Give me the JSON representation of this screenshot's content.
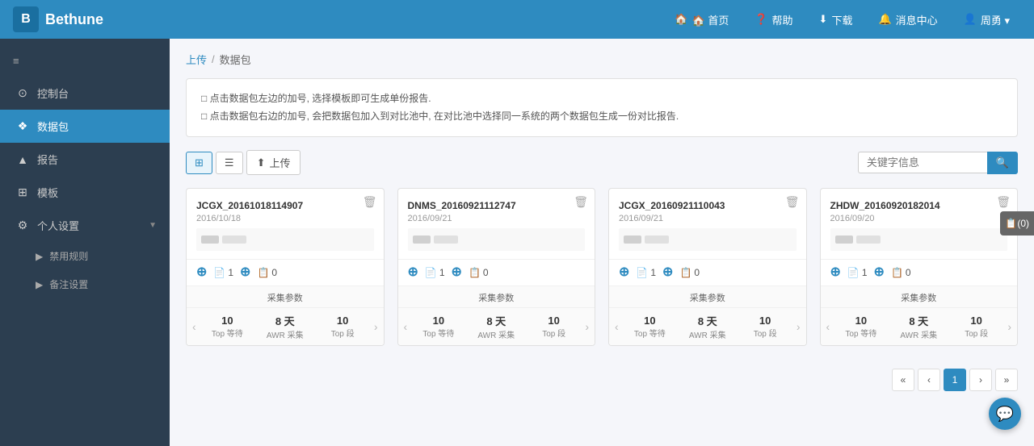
{
  "header": {
    "logo_text": "Bethune",
    "logo_letter": "B",
    "nav": [
      {
        "label": "🏠 首页",
        "key": "home"
      },
      {
        "label": "❓ 帮助",
        "key": "help"
      },
      {
        "label": "⬇ 下载",
        "key": "download"
      },
      {
        "label": "🔔 消息中心",
        "key": "messages"
      },
      {
        "label": "👤 周勇",
        "key": "user"
      }
    ]
  },
  "sidebar": {
    "menu_icon": "≡",
    "items": [
      {
        "label": "控制台",
        "key": "console",
        "icon": "⊙",
        "active": false
      },
      {
        "label": "数据包",
        "key": "datapackage",
        "icon": "❖",
        "active": true
      },
      {
        "label": "报告",
        "key": "report",
        "icon": "▲",
        "active": false
      },
      {
        "label": "模板",
        "key": "template",
        "icon": "⊞",
        "active": false
      },
      {
        "label": "个人设置",
        "key": "settings",
        "icon": "⚙",
        "active": false,
        "has_arrow": true
      },
      {
        "label": "禁用规则",
        "key": "rules",
        "icon": "▶",
        "active": false,
        "sub": true
      },
      {
        "label": "备注设置",
        "key": "notes",
        "icon": "▶",
        "active": false,
        "sub": true
      }
    ]
  },
  "breadcrumb": {
    "upload": "上传",
    "separator": "/",
    "current": "数据包"
  },
  "info": {
    "line1": "□ 点击数据包左边的加号, 选择模板即可生成单份报告.",
    "line2": "□ 点击数据包右边的加号, 会把数据包加入到对比池中, 在对比池中选择同一系统的两个数据包生成一份对比报告."
  },
  "toolbar": {
    "grid_label": "",
    "list_label": "",
    "upload_label": "上传",
    "search_placeholder": "关键字信息",
    "search_btn": "🔍"
  },
  "float_badge": {
    "label": "📋(0)"
  },
  "cards": [
    {
      "title": "JCGX_20161018114907",
      "date": "2016/10/18",
      "count1": "1",
      "count2": "0",
      "stats_label": "采集参数",
      "stat1_value": "10",
      "stat1_label": "Top 等待",
      "stat2_value": "8 天",
      "stat2_label": "AWR 采集",
      "stat3_value": "10",
      "stat3_label": "Top 段"
    },
    {
      "title": "DNMS_20160921112747",
      "date": "2016/09/21",
      "count1": "1",
      "count2": "0",
      "stats_label": "采集参数",
      "stat1_value": "10",
      "stat1_label": "Top 等待",
      "stat2_value": "8 天",
      "stat2_label": "AWR 采集",
      "stat3_value": "10",
      "stat3_label": "Top 段"
    },
    {
      "title": "JCGX_20160921110043",
      "date": "2016/09/21",
      "count1": "1",
      "count2": "0",
      "stats_label": "采集参数",
      "stat1_value": "10",
      "stat1_label": "Top 等待",
      "stat2_value": "8 天",
      "stat2_label": "AWR 采集",
      "stat3_value": "10",
      "stat3_label": "Top 段"
    },
    {
      "title": "ZHDW_20160920182014",
      "date": "2016/09/20",
      "count1": "1",
      "count2": "0",
      "stats_label": "采集参数",
      "stat1_value": "10",
      "stat1_label": "Top 等待",
      "stat2_value": "8 天",
      "stat2_label": "AWR 采集",
      "stat3_value": "10",
      "stat3_label": "Top 段"
    }
  ],
  "pagination": {
    "first": "«",
    "prev": "‹",
    "current": "1",
    "next": "›",
    "last": "»"
  }
}
